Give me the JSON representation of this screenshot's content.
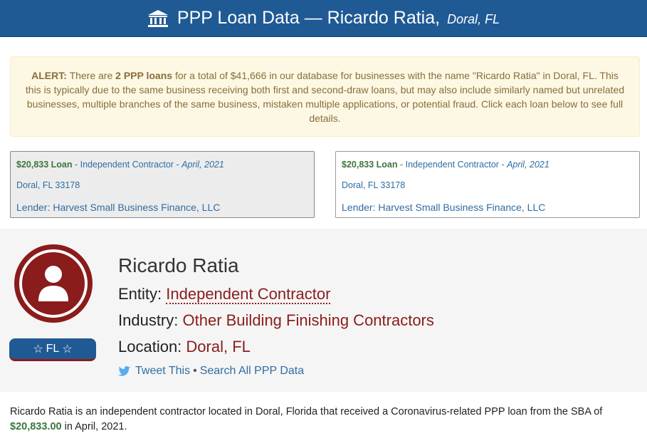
{
  "header": {
    "title": "PPP Loan Data — Ricardo Ratia,",
    "location": "Doral, FL",
    "icon": "bank-icon"
  },
  "alert": {
    "label": "ALERT:",
    "text_a": "There are",
    "count_text": "2 PPP loans",
    "text_b": "for a total of $41,666 in our database for businesses with the name \"Ricardo Ratia\" in Doral, FL. This this is typically due to the same business receiving both first and second-draw loans, but may also include similarly named but unrelated businesses, multiple branches of the same business, mistaken multiple applications, or potential fraud. Click each loan below to see full details."
  },
  "loans": [
    {
      "amount": "$20,833 Loan",
      "sep1": " - ",
      "entity": "Independent Contractor",
      "sep2": " - ",
      "date": "April, 2021",
      "address": "Doral, FL 33178",
      "lender": "Lender: Harvest Small Business Finance, LLC"
    },
    {
      "amount": "$20,833 Loan",
      "sep1": " - ",
      "entity": "Independent Contractor",
      "sep2": " - ",
      "date": "April, 2021",
      "address": "Doral, FL 33178",
      "lender": "Lender: Harvest Small Business Finance, LLC"
    }
  ],
  "profile": {
    "name": "Ricardo Ratia",
    "entity_label": "Entity:",
    "entity_value": "Independent Contractor",
    "industry_label": "Industry:",
    "industry_value": "Other Building Finishing Contractors",
    "location_label": "Location:",
    "location_value": "Doral, FL",
    "state_badge": "FL",
    "tweet_label": "Tweet This",
    "share_sep": "•",
    "search_label": "Search All PPP Data"
  },
  "summary": {
    "text_a": "Ricardo Ratia is an independent contractor located in Doral, Florida that received a Coronavirus-related PPP loan from the SBA of",
    "amount": "$20,833.00",
    "text_b": "in April, 2021."
  },
  "colors": {
    "header_bg": "#1f5a94",
    "accent_red": "#8b1c1c",
    "link_blue": "#2f6da3",
    "money_green": "#3c763d",
    "alert_bg": "#fcf8e3"
  }
}
